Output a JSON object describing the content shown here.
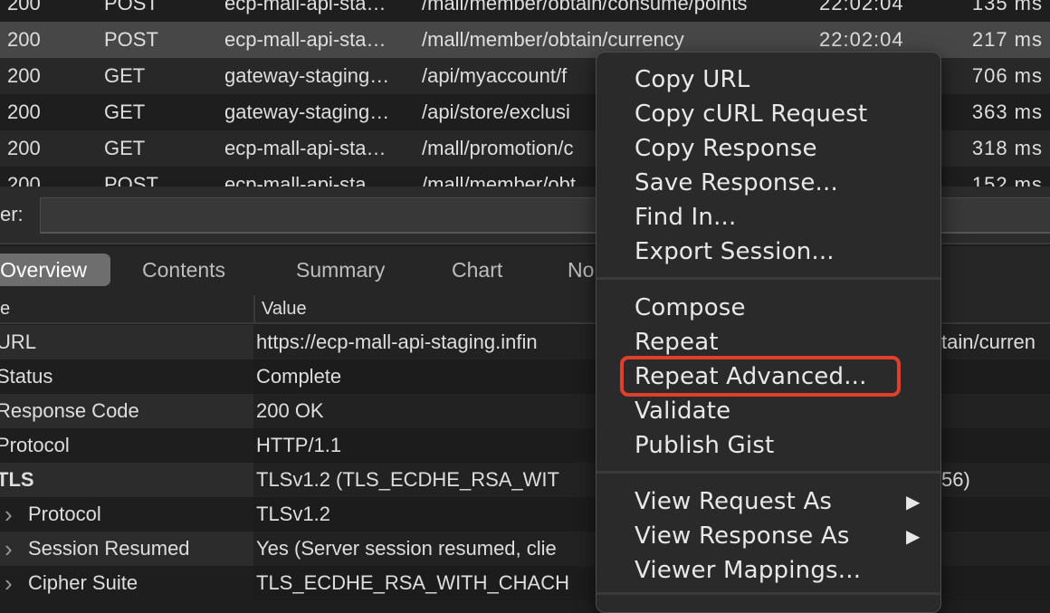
{
  "requests": [
    {
      "code": "200",
      "method": "POST",
      "host": "ecp-mall-api-sta…",
      "path": "/mall/member/obtain/consume/points",
      "time": "22:02:04",
      "duration": "135 ms"
    },
    {
      "code": "200",
      "method": "POST",
      "host": "ecp-mall-api-sta…",
      "path": "/mall/member/obtain/currency",
      "time": "22:02:04",
      "duration": "217 ms",
      "selected": true
    },
    {
      "code": "200",
      "method": "GET",
      "host": "gateway-staging…",
      "path": "/api/myaccount/f",
      "time": "",
      "duration": "706 ms"
    },
    {
      "code": "200",
      "method": "GET",
      "host": "gateway-staging…",
      "path": "/api/store/exclusi",
      "time": "",
      "duration": "363 ms"
    },
    {
      "code": "200",
      "method": "GET",
      "host": "ecp-mall-api-sta…",
      "path": "/mall/promotion/c",
      "time": "",
      "duration": "318 ms"
    },
    {
      "code": "200",
      "method": "POST",
      "host": "ecp-mall-api-sta…",
      "path": "/mall/member/obt",
      "time": "",
      "duration": "152 ms"
    }
  ],
  "filter": {
    "label": "er:",
    "value": ""
  },
  "tabs": [
    {
      "label": "Overview",
      "active": true
    },
    {
      "label": "Contents"
    },
    {
      "label": "Summary"
    },
    {
      "label": "Chart"
    },
    {
      "label": "No"
    }
  ],
  "overview": {
    "header": {
      "name": "e",
      "value": "Value"
    },
    "rows": [
      {
        "name": "URL",
        "value": "https://ecp-mall-api-staging.infin",
        "value_tail": "tain/curren"
      },
      {
        "name": "Status",
        "value": "Complete"
      },
      {
        "name": "Response Code",
        "value": "200 OK"
      },
      {
        "name": "Protocol",
        "value": "HTTP/1.1"
      },
      {
        "name": "TLS",
        "value": "TLSv1.2 (TLS_ECDHE_RSA_WIT",
        "value_tail": "56)",
        "bold": true
      },
      {
        "name": "Protocol",
        "value": "TLSv1.2",
        "child": true
      },
      {
        "name": "Session Resumed",
        "value": "Yes (Server session resumed, clie",
        "child": true
      },
      {
        "name": "Cipher Suite",
        "value": "TLS_ECDHE_RSA_WITH_CHACH",
        "child": true
      }
    ]
  },
  "context_menu": {
    "groups": [
      [
        "Copy URL",
        "Copy cURL Request",
        "Copy Response",
        "Save Response...",
        "Find In...",
        "Export Session..."
      ],
      [
        "Compose",
        "Repeat",
        "Repeat Advanced...",
        "Validate",
        "Publish Gist"
      ],
      [
        "View Request As",
        "View Response As",
        "Viewer Mappings..."
      ]
    ],
    "highlighted": "Repeat Advanced...",
    "submenu_items": [
      "View Request As",
      "View Response As"
    ]
  },
  "colors": {
    "highlight_box": "#e0402b",
    "selected_row": "#474747"
  }
}
